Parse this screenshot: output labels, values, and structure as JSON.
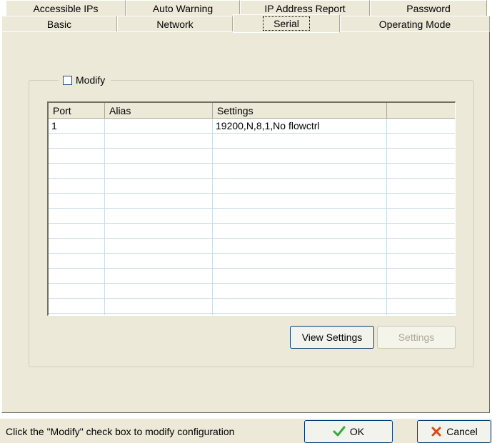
{
  "tabs_row1": [
    {
      "label": "Accessible IPs"
    },
    {
      "label": "Auto Warning"
    },
    {
      "label": "IP Address Report"
    },
    {
      "label": "Password"
    }
  ],
  "tabs_row2": [
    {
      "label": "Basic"
    },
    {
      "label": "Network"
    },
    {
      "label": "Serial"
    },
    {
      "label": "Operating Mode"
    }
  ],
  "active_tab": "Serial",
  "modify": {
    "label": "Modify",
    "checked": false
  },
  "table": {
    "columns": [
      "Port",
      "Alias",
      "Settings",
      ""
    ],
    "rows": [
      {
        "port": "1",
        "alias": "",
        "settings": "19200,N,8,1,No flowctrl"
      }
    ]
  },
  "buttons": {
    "view_settings": "View Settings",
    "settings": "Settings",
    "ok": "OK",
    "cancel": "Cancel"
  },
  "status_text": "Click the \"Modify\" check box to modify configuration",
  "colors": {
    "panel": "#ece9d8",
    "ok_check": "#3aa83a",
    "cancel_x": "#d84a1a"
  }
}
